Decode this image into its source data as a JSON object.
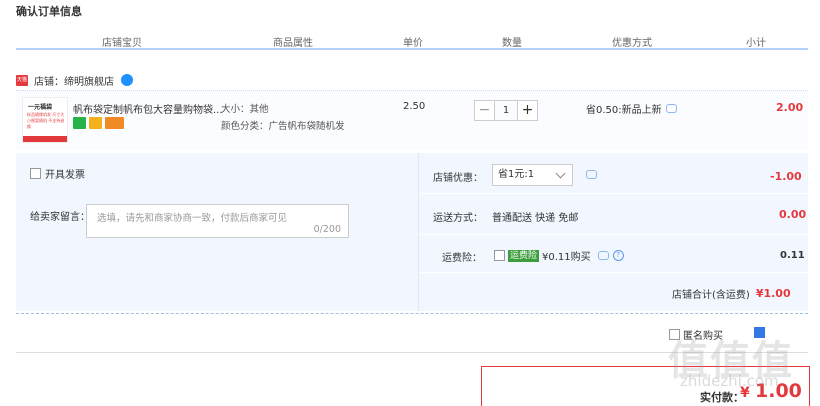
{
  "page_title": "确认订单信息",
  "columns": [
    "店铺宝贝",
    "商品属性",
    "单价",
    "数量",
    "优惠方式",
    "小计"
  ],
  "shop": {
    "tmall_badge": "天猫",
    "label": "店铺：缔明旗舰店"
  },
  "item": {
    "thumb_title": "一元福袋",
    "thumb_sub": "样品随缘机发 尺寸大小图案随机 不支持退换",
    "name": "帆布袋定制帆布包大容量购物袋...",
    "attr_size": "大小：其他",
    "attr_color": "颜色分类：广告帆布袋随机发",
    "price": "2.50",
    "qty_minus": "−",
    "qty": "1",
    "qty_plus": "+",
    "promo": "省0.50:新品上新",
    "subtotal": "2.00"
  },
  "invoice_label": "开具发票",
  "message": {
    "label": "给卖家留言：",
    "placeholder": "选填，请先和商家协商一致，付款后商家可见",
    "counter": "0/200"
  },
  "shop_discount": {
    "label": "店铺优惠：",
    "selected": "省1元:1",
    "value": "-1.00"
  },
  "shipping": {
    "label": "运送方式：",
    "value": "普通配送 快递 免邮",
    "amount": "0.00"
  },
  "insurance": {
    "label": "运费险：",
    "tag": "运费险",
    "price": "¥0.11购买",
    "amount": "0.11"
  },
  "shop_total": {
    "label": "店铺合计(含运费)",
    "value": "¥1.00"
  },
  "anonymous_label": "匿名购买",
  "payment": {
    "label": "实付款：",
    "currency": "¥",
    "value": "1.00"
  },
  "watermark": {
    "main": "值值值",
    "sub": "zhidezhi.com"
  },
  "colors": {
    "accent": "#e4393c",
    "header_line": "#b2d1ff",
    "panel_bg": "#f2f7ff"
  }
}
